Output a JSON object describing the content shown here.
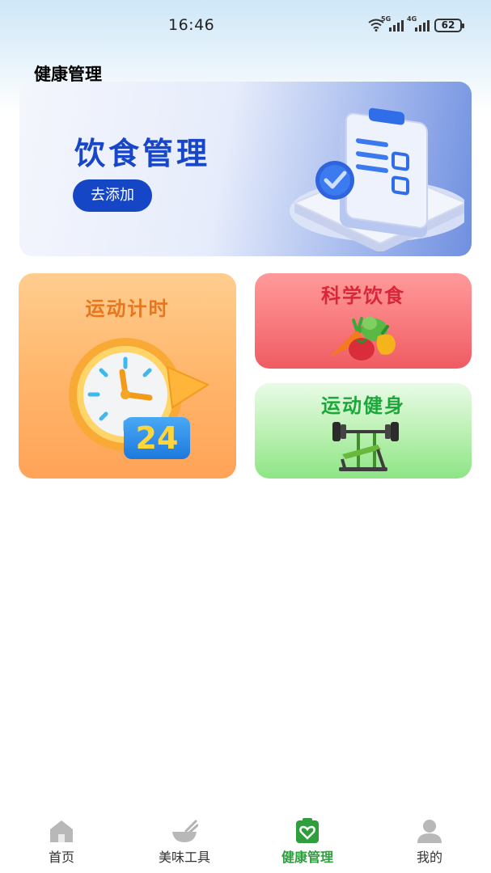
{
  "status_bar": {
    "time": "16:46",
    "network_1": "5G",
    "network_2": "4G",
    "battery": "62"
  },
  "page": {
    "title": "健康管理"
  },
  "banner": {
    "title": "饮食管理",
    "button_label": "去添加"
  },
  "cards": {
    "timer": {
      "title": "运动计时",
      "badge": "24"
    },
    "diet": {
      "title": "科学饮食"
    },
    "fitness": {
      "title": "运动健身"
    }
  },
  "bottom_nav": {
    "items": [
      {
        "label": "首页",
        "icon": "home-icon"
      },
      {
        "label": "美味工具",
        "icon": "bowl-icon"
      },
      {
        "label": "健康管理",
        "icon": "health-clipboard-icon"
      },
      {
        "label": "我的",
        "icon": "profile-icon"
      }
    ],
    "active_index": 2
  },
  "colors": {
    "accent_green": "#2e9f3c",
    "banner_blue": "#1546c6",
    "timer_orange": "#ffb66b",
    "diet_red": "#ef5b62",
    "fitness_green": "#8de585"
  }
}
